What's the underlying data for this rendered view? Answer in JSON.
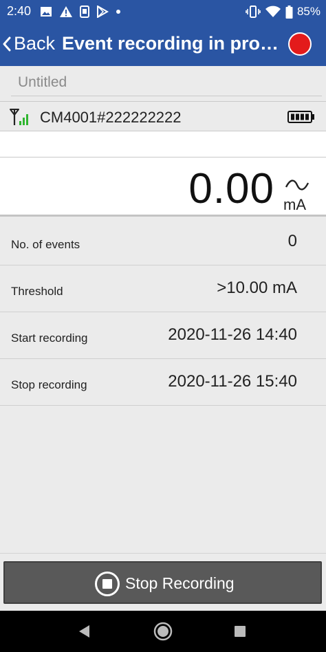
{
  "status_bar": {
    "time": "2:40",
    "battery_percent": "85%",
    "icons_left": [
      "image-icon",
      "warning-icon",
      "phone-sim-icon",
      "play-store-icon",
      "dot-icon"
    ],
    "icons_right": [
      "vibrate-icon",
      "wifi-icon",
      "battery-icon"
    ]
  },
  "nav": {
    "back_label": "Back",
    "title": "Event recording in pro…",
    "record_indicator_color": "#e31b1b"
  },
  "recording": {
    "name_placeholder": "Untitled"
  },
  "device": {
    "name": "CM4001#222222222",
    "signal_icon": "antenna-signal-icon",
    "battery_icon": "battery-icon"
  },
  "reading": {
    "value": "0.00",
    "unit": "mA",
    "mode_icon": "ac-wave-icon"
  },
  "info": {
    "rows": [
      {
        "label": "No. of events",
        "value": "0"
      },
      {
        "label": "Threshold",
        "value": ">10.00 mA"
      },
      {
        "label": "Start recording",
        "value": "2020-11-26 14:40"
      },
      {
        "label": "Stop recording",
        "value": "2020-11-26 15:40"
      }
    ]
  },
  "actions": {
    "stop_label": "Stop Recording"
  },
  "colors": {
    "header_blue": "#2a55a3",
    "button_gray": "#595959"
  }
}
